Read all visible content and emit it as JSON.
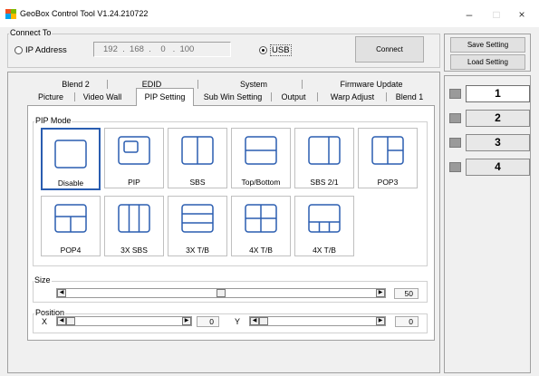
{
  "window": {
    "title": "GeoBox Control Tool  V1.24.210722",
    "minimize_glyph": "–",
    "maximize_glyph": "□",
    "close_glyph": "×"
  },
  "connect": {
    "legend": "Connect To",
    "ip_label": "IP Address",
    "ip_selected": false,
    "ip_value": "192  .  168  .    0   .  100",
    "usb_label": "USB",
    "usb_selected": true,
    "connect_label": "Connect"
  },
  "settings": {
    "save_label": "Save Setting",
    "load_label": "Load Setting"
  },
  "tabs": {
    "row_top": [
      "Blend 2",
      "EDID",
      "System",
      "Firmware Update"
    ],
    "row_bottom": [
      "Picture",
      "Video Wall",
      "PIP Setting",
      "Sub Win Setting",
      "Output",
      "Warp Adjust",
      "Blend 1"
    ],
    "active": "PIP Setting"
  },
  "pip": {
    "legend": "PIP Mode",
    "modes": [
      {
        "label": "Disable",
        "icon": "disable-layout-icon",
        "selected": true
      },
      {
        "label": "PIP",
        "icon": "pip-layout-icon",
        "selected": false
      },
      {
        "label": "SBS",
        "icon": "sbs-layout-icon",
        "selected": false
      },
      {
        "label": "Top/Bottom",
        "icon": "top-bottom-layout-icon",
        "selected": false
      },
      {
        "label": "SBS 2/1",
        "icon": "sbs-2-1-layout-icon",
        "selected": false
      },
      {
        "label": "POP3",
        "icon": "pop3-layout-icon",
        "selected": false
      },
      {
        "label": "POP4",
        "icon": "pop4-layout-icon",
        "selected": false
      },
      {
        "label": "3X SBS",
        "icon": "3x-sbs-layout-icon",
        "selected": false
      },
      {
        "label": "3X T/B",
        "icon": "3x-tb-layout-icon",
        "selected": false
      },
      {
        "label": "4X T/B",
        "icon": "4x-grid-layout-icon",
        "selected": false
      },
      {
        "label": "4X T/B",
        "icon": "4x-tb-layout-icon",
        "selected": false
      }
    ]
  },
  "size": {
    "legend": "Size",
    "value": "50",
    "fraction": 0.5
  },
  "position": {
    "legend": "Position",
    "x_label": "X",
    "x_value": "0",
    "x_fraction": 0,
    "y_label": "Y",
    "y_value": "0",
    "y_fraction": 0
  },
  "layers": [
    {
      "label": "1",
      "active": true
    },
    {
      "label": "2",
      "active": false
    },
    {
      "label": "3",
      "active": false
    },
    {
      "label": "4",
      "active": false
    }
  ],
  "colors": {
    "accent": "#2a5db0",
    "layout_icon": "#2a5db0",
    "background": "#f0f0f0"
  }
}
